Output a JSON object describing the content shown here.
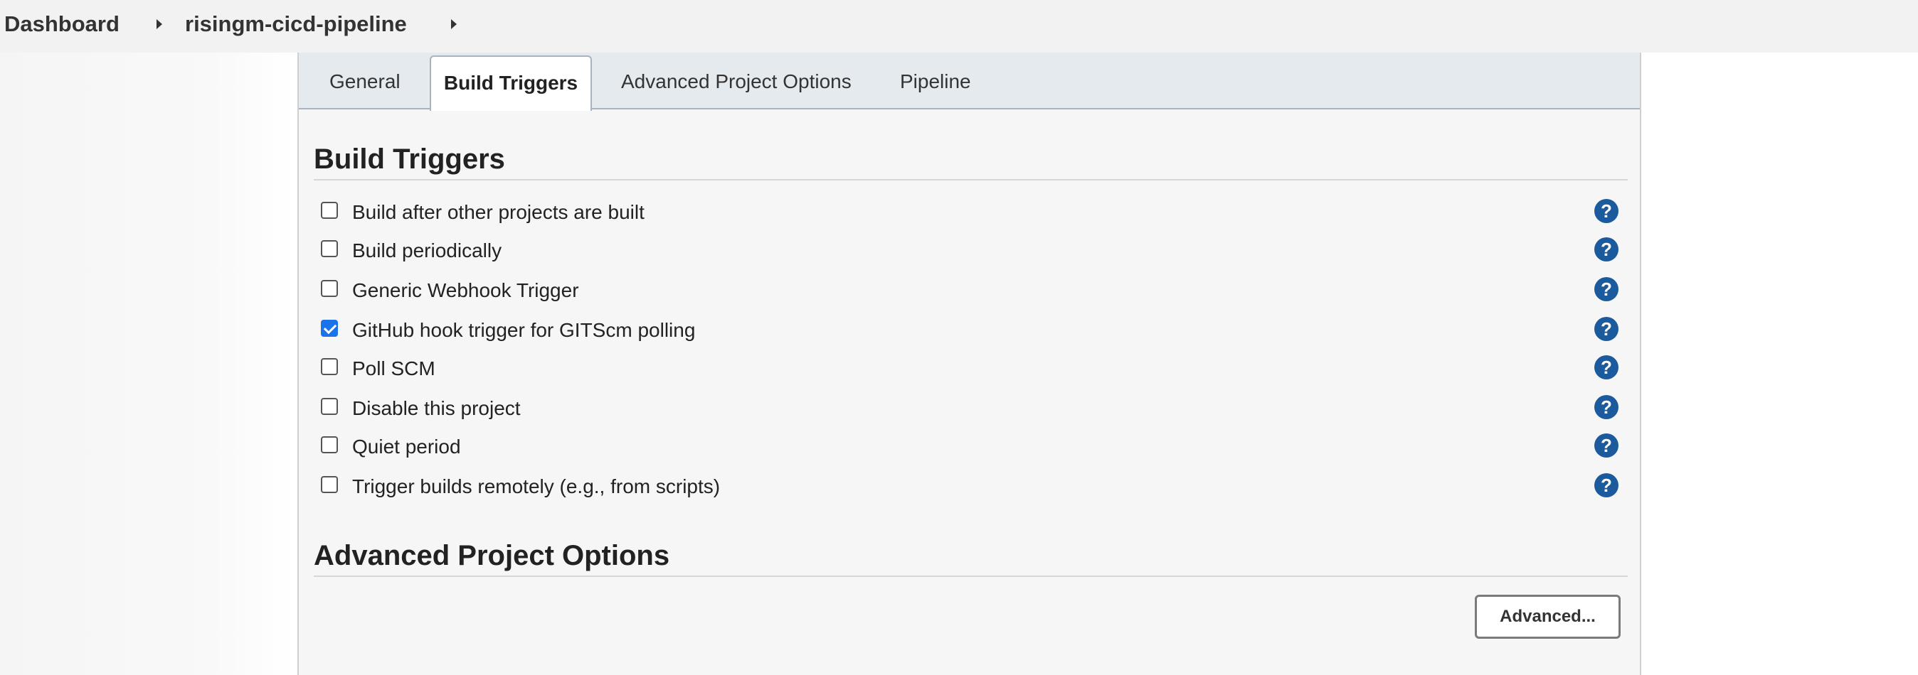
{
  "breadcrumb": {
    "items": [
      "Dashboard",
      "risingm-cicd-pipeline"
    ]
  },
  "tabs": {
    "items": [
      "General",
      "Build Triggers",
      "Advanced Project Options",
      "Pipeline"
    ],
    "active": "Build Triggers"
  },
  "build_triggers": {
    "title": "Build Triggers",
    "options": [
      {
        "label": "Build after other projects are built",
        "checked": false
      },
      {
        "label": "Build periodically",
        "checked": false
      },
      {
        "label": "Generic Webhook Trigger",
        "checked": false
      },
      {
        "label": "GitHub hook trigger for GITScm polling",
        "checked": true
      },
      {
        "label": "Poll SCM",
        "checked": false
      },
      {
        "label": "Disable this project",
        "checked": false
      },
      {
        "label": "Quiet period",
        "checked": false
      },
      {
        "label": "Trigger builds remotely (e.g., from scripts)",
        "checked": false
      }
    ],
    "help_icon_glyph": "?"
  },
  "advanced_project_options": {
    "title": "Advanced Project Options",
    "button_label": "Advanced..."
  },
  "colors": {
    "accent_checkbox": "#1a73e8",
    "help_icon": "#1b5a9c"
  },
  "icons": {
    "breadcrumb_separator": "chevron-right-icon",
    "help": "help-icon"
  }
}
